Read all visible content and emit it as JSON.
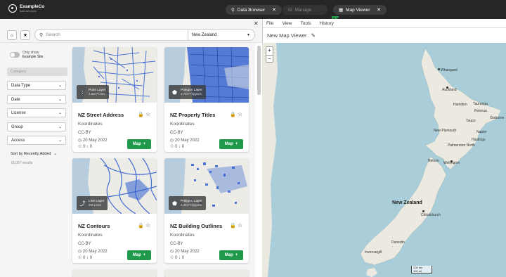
{
  "app": {
    "logo_name": "ExampleCo",
    "logo_sub": "data services"
  },
  "tabs": [
    {
      "label": "Data Browser",
      "icon": "search-icon",
      "closable": true
    },
    {
      "label": "Manage",
      "icon": "database-icon",
      "closable": false
    },
    {
      "label": "Map Viewer",
      "icon": "map-icon",
      "closable": true
    }
  ],
  "search": {
    "placeholder": "Search",
    "location": "New Zealand"
  },
  "filters": {
    "toggle_line1": "Only show",
    "toggle_line2": "Example Site",
    "category": "Category",
    "selects": [
      "Data Type",
      "Date",
      "License",
      "Group",
      "Access"
    ],
    "sort": "Sort by Recently Added",
    "results": "18,057 results"
  },
  "cards": [
    {
      "title": "NZ Street Address",
      "org": "Koordinates",
      "license": "CC-BY",
      "date": "20 May 2022",
      "views": "0",
      "downloads": "0",
      "layer_type": "Point Layer",
      "layer_size": "2.5M Points",
      "map_label": "Map"
    },
    {
      "title": "NZ Property Titles",
      "org": "Koordinates",
      "license": "CC-BY",
      "date": "20 May 2022",
      "views": "0",
      "downloads": "0",
      "layer_type": "Polygon Layer",
      "layer_size": "2.7M Polygons",
      "map_label": "Map"
    },
    {
      "title": "NZ Contours",
      "org": "Koordinates",
      "license": "CC-BY",
      "date": "20 May 2022",
      "views": "0",
      "downloads": "0",
      "layer_type": "Line Layer",
      "layer_size": "2M Lines",
      "map_label": "Map"
    },
    {
      "title": "NZ Building Outlines",
      "org": "Koordinates",
      "license": "CC-BY",
      "date": "20 May 2022",
      "views": "0",
      "downloads": "0",
      "layer_type": "Polygon Layer",
      "layer_size": "4.4M Polygons",
      "map_label": "Map"
    }
  ],
  "map_viewer": {
    "menu": [
      "File",
      "View",
      "Tools",
      "History"
    ],
    "title": "New Map Viewer",
    "zoom_in": "+",
    "zoom_out": "−",
    "scale_top": "200 km",
    "scale_bottom": "100 mi",
    "country": "New Zealand",
    "cities": [
      "Whangarei",
      "Auckland",
      "Hamilton",
      "Tauranga",
      "Rotorua",
      "Gisborne",
      "Taupo",
      "Napier",
      "Hastings",
      "New Plymouth",
      "Palmerston North",
      "Wellington",
      "Nelson",
      "Christchurch",
      "Dunedin",
      "Invercargill"
    ]
  },
  "colors": {
    "accent_green": "#1e9a4a",
    "topbar": "#262626",
    "water": "#a9cdd9",
    "land": "#ece9e1",
    "data_blue": "#2f5fd0"
  }
}
